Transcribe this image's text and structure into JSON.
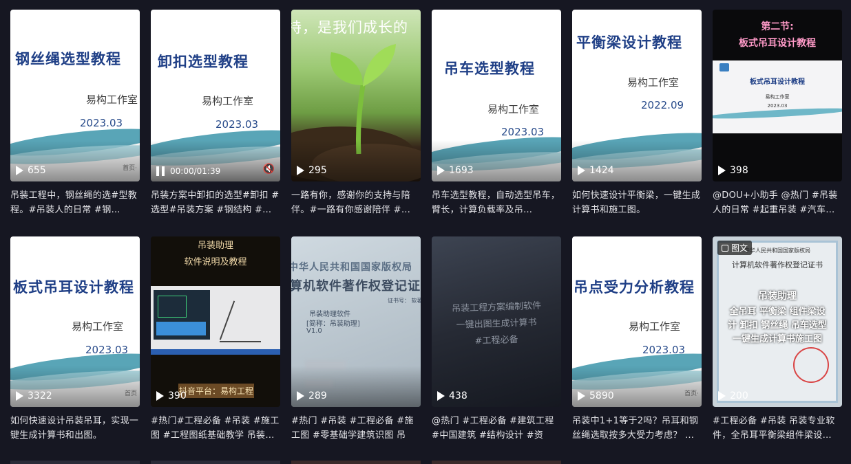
{
  "cards": [
    {
      "slide_title": "钢丝绳选型教程",
      "slide_sub": "易构工作室",
      "slide_date": "2023.03",
      "plays": "655",
      "foot": "首页·",
      "desc": "吊装工程中，钢丝绳的选#型教程。#吊装人的日常 #钢…"
    },
    {
      "slide_title": "卸扣选型教程",
      "slide_sub": "易构工作室",
      "slide_date": "2023.03",
      "time": "00:00/01:39",
      "mute": "🔇",
      "desc": "吊装方案中卸扣的选型#卸扣 #选型#吊装方案 #钢结构 #…"
    },
    {
      "overlay_text": "持，是我们成长的",
      "plays": "295",
      "desc": "一路有你，感谢你的支持与陪伴。#一路有你感谢陪伴 #…"
    },
    {
      "slide_title": "吊车选型教程",
      "slide_sub": "易构工作室",
      "slide_date": "2023.03",
      "plays": "1693",
      "desc": "吊车选型教程，自动选型吊车，臂长，计算负载率及吊…"
    },
    {
      "slide_title": "平衡梁设计教程",
      "slide_sub": "易构工作室",
      "slide_date": "2022.09",
      "plays": "1424",
      "desc": "如何快速设计平衡梁，一键生成计算书和施工图。"
    },
    {
      "top_line1": "第二节:",
      "top_line2": "板式吊耳设计教程",
      "inner_title": "板式吊耳设计教程",
      "inner_sub": "易构工作室",
      "inner_date": "2023.03",
      "plays": "398",
      "desc": "@DOU+小助手 @热门 #吊装人的日常 #起重吊装 #汽车…"
    },
    {
      "slide_title": "板式吊耳设计教程",
      "slide_sub": "易构工作室",
      "slide_date": "2023.03",
      "plays": "3322",
      "foot": "首页",
      "desc": "如何快速设计吊装吊耳，实现一键生成计算书和出图。"
    },
    {
      "top_line1": "吊装助理",
      "top_line2": "软件说明及教程",
      "bottom_text": "抖音平台：易构工程",
      "plays": "390",
      "desc": "#热门#工程必备 #吊装 #施工图 #工程图纸基础教学 吊装…"
    },
    {
      "cert_title1": "中华人民共和国国家版权局",
      "cert_title2": "算机软件著作权登记证",
      "cert_no": "证书号：  软著登",
      "cert_line1": "吊装助理软件",
      "cert_line2": "[简称：吊装助理]",
      "cert_line3": "V1.0",
      "plays": "289",
      "desc": "#热门 #吊装 #工程必备 #施工图 #零基础学建筑识图 吊装…"
    },
    {
      "dark_line1": "吊装工程方案编制软件",
      "dark_line2": "一键出图生成计算书",
      "dark_line3": "#工程必备",
      "plays": "438",
      "desc": "@热门 #工程必备 #建筑工程 #中国建筑 #结构设计 #资质…"
    },
    {
      "slide_title": "吊点受力分析教程",
      "slide_sub": "易构工作室",
      "slide_date": "2023.03",
      "plays": "5890",
      "foot": "首页·",
      "desc": "吊装中1+1等于2吗？吊耳和钢丝绳选取按多大受力考虑？ …"
    },
    {
      "badge": "图文",
      "cert_head": "中华人民共和国国家版权局",
      "cert_title": "计算机软件著作权登记证书",
      "ov1": "吊装助理",
      "ov2": "全吊耳 平衡梁 组件梁设",
      "ov3": "计 卸扣 钢丝绳 吊车选型",
      "ov4": "一键生成计算书施工图",
      "plays": "200",
      "desc": "#工程必备 #吊装 吊装专业软件，全吊耳平衡梁组件梁设…"
    }
  ]
}
